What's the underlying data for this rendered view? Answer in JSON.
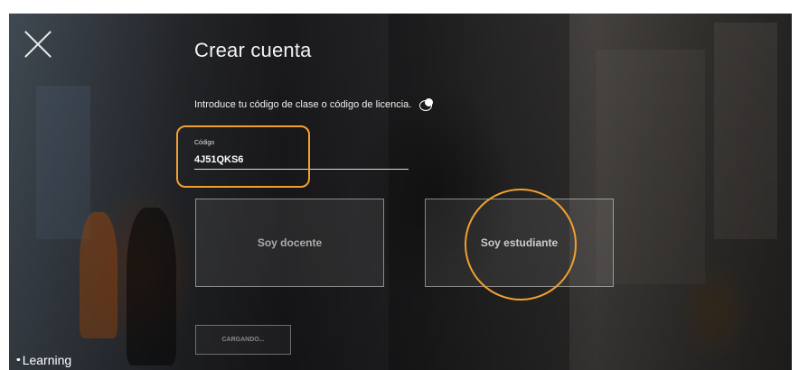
{
  "header": {
    "title": "Crear cuenta"
  },
  "form": {
    "instruction": "Introduce tu código de clase o código de licencia.",
    "code_label": "Código",
    "code_value": "4J51QKS6"
  },
  "roles": {
    "teacher_label": "Soy docente",
    "student_label": "Soy estudiante"
  },
  "actions": {
    "loading_label": "CARGANDO..."
  },
  "brand": {
    "dots": "••",
    "name": "Learning"
  },
  "colors": {
    "highlight": "#f0a030",
    "text": "#f2f2f2"
  },
  "icons": {
    "close": "close-icon",
    "help": "chat-help-icon"
  }
}
